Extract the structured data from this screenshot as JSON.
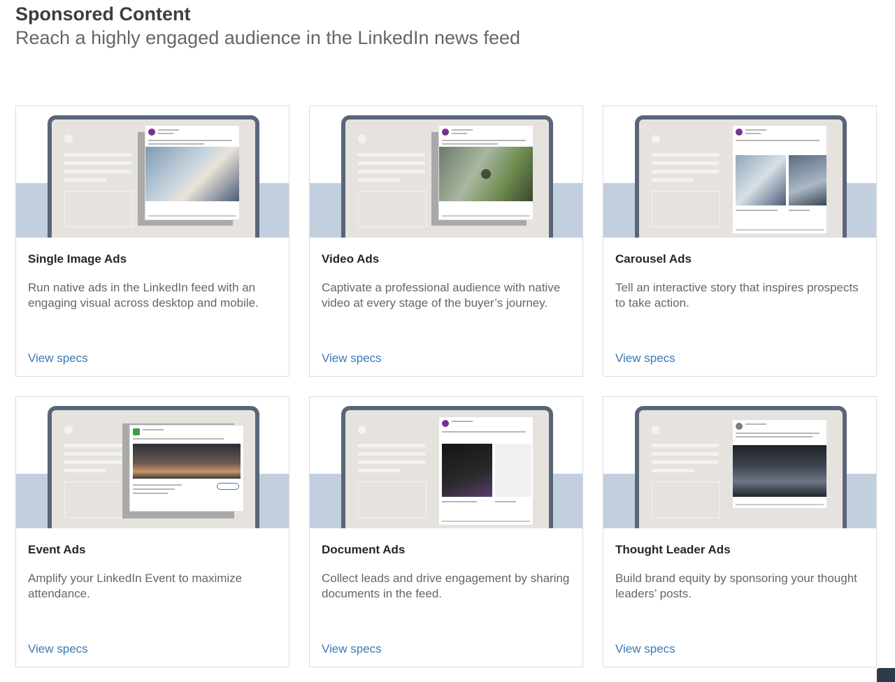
{
  "header": {
    "title": "Sponsored Content",
    "subtitle": "Reach a highly engaged audience in the LinkedIn news feed"
  },
  "colors": {
    "link": "#3b78b5",
    "band": "#c2cfdf",
    "laptop_frame": "#5a6678",
    "laptop_screen": "#e6e3df"
  },
  "cards": [
    {
      "title": "Single Image Ads",
      "description": "Run native ads in the LinkedIn feed with an engaging visual across desktop and mobile.",
      "link": "View specs"
    },
    {
      "title": "Video Ads",
      "description": "Captivate a professional audience with native video at every stage of the buyer’s journey.",
      "link": "View specs"
    },
    {
      "title": "Carousel Ads",
      "description": "Tell an interactive story that inspires prospects to take action.",
      "link": "View specs"
    },
    {
      "title": "Event Ads",
      "description": "Amplify your LinkedIn Event to maximize attendance.",
      "link": "View specs"
    },
    {
      "title": "Document Ads",
      "description": "Collect leads and drive engagement by sharing documents in the feed.",
      "link": "View specs"
    },
    {
      "title": "Thought Leader Ads",
      "description": "Build brand equity by sponsoring your thought leaders’ posts.",
      "link": "View specs"
    }
  ]
}
